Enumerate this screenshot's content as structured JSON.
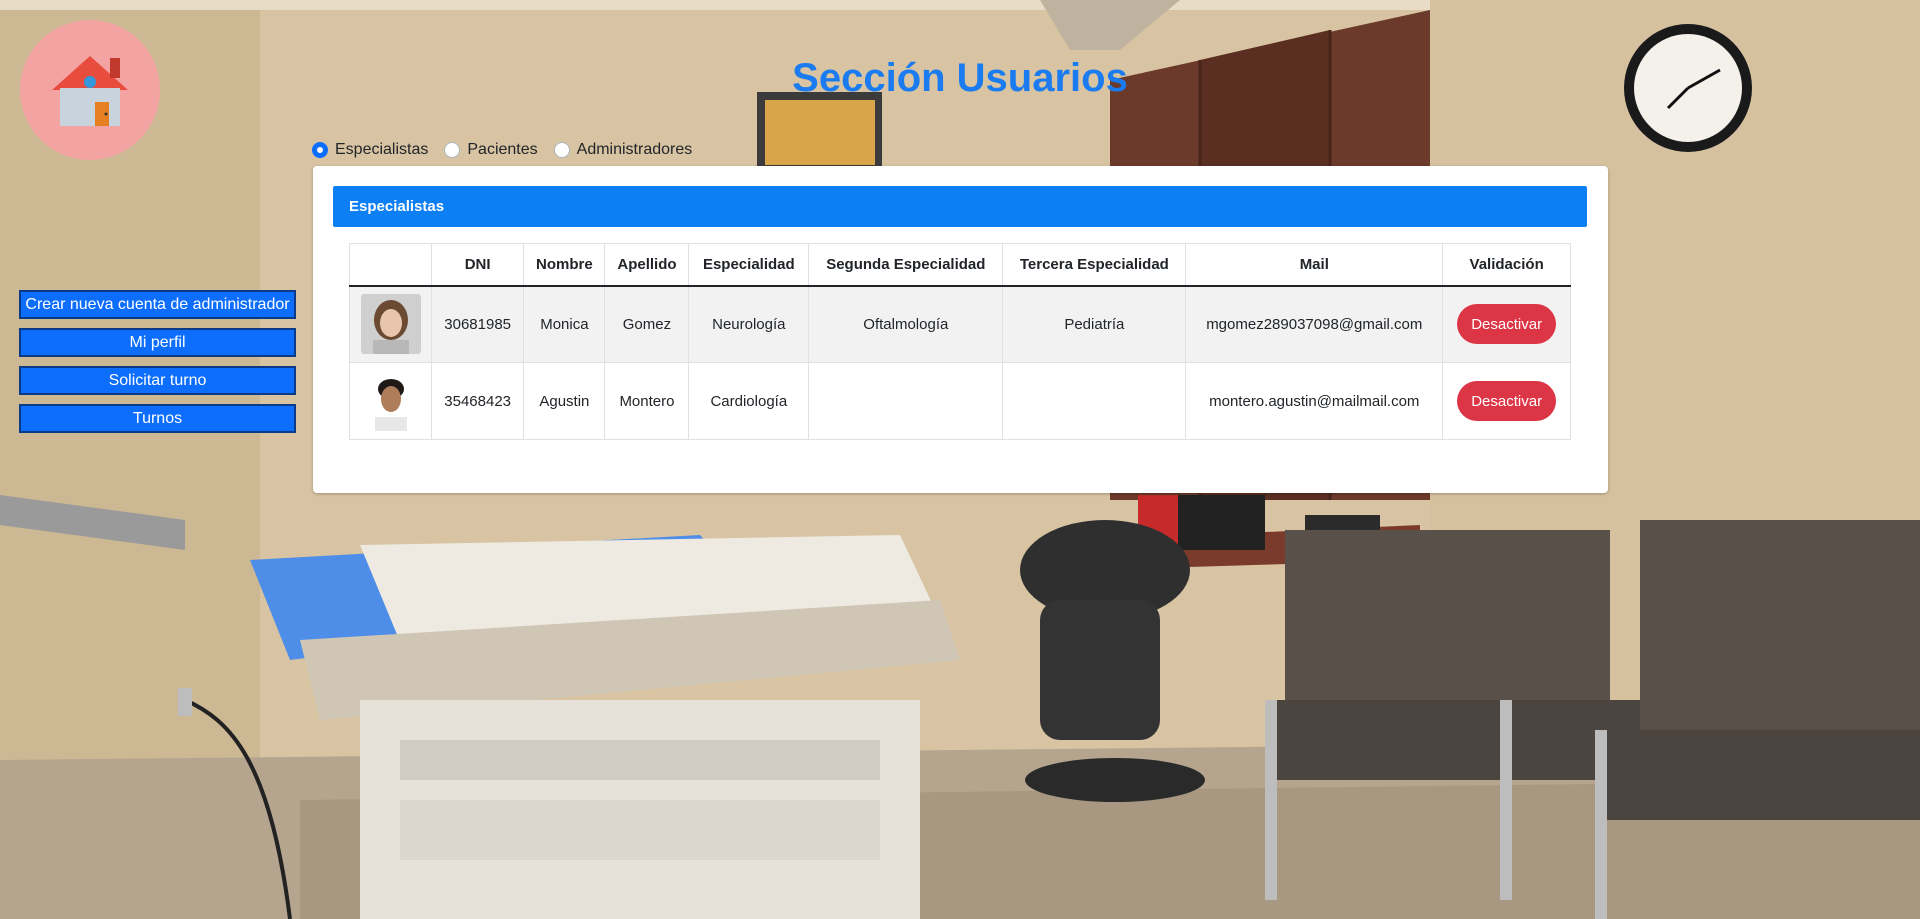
{
  "page": {
    "title": "Sección Usuarios"
  },
  "colors": {
    "accent": "#0d6efd",
    "title": "#1a7cf0",
    "danger": "#dc3545",
    "home_bg": "#f4a3a3"
  },
  "icons": {
    "home": "house-icon"
  },
  "filters": {
    "options": [
      {
        "label": "Especialistas",
        "checked": true
      },
      {
        "label": "Pacientes",
        "checked": false
      },
      {
        "label": "Administradores",
        "checked": false
      }
    ]
  },
  "side_menu": {
    "items": [
      {
        "label": "Crear nueva cuenta de administrador"
      },
      {
        "label": "Mi perfil"
      },
      {
        "label": "Solicitar turno"
      },
      {
        "label": "Turnos"
      }
    ]
  },
  "card": {
    "header": "Especialistas"
  },
  "table": {
    "columns": [
      "",
      "DNI",
      "Nombre",
      "Apellido",
      "Especialidad",
      "Segunda Especialidad",
      "Tercera Especialidad",
      "Mail",
      "Validación"
    ],
    "rows": [
      {
        "dni": "30681985",
        "nombre": "Monica",
        "apellido": "Gomez",
        "especialidad": "Neurología",
        "segunda": "Oftalmología",
        "tercera": "Pediatría",
        "mail": "mgomez289037098@gmail.com",
        "action": "Desactivar"
      },
      {
        "dni": "35468423",
        "nombre": "Agustin",
        "apellido": "Montero",
        "especialidad": "Cardiología",
        "segunda": "",
        "tercera": "",
        "mail": "montero.agustin@mailmail.com",
        "action": "Desactivar"
      }
    ]
  }
}
